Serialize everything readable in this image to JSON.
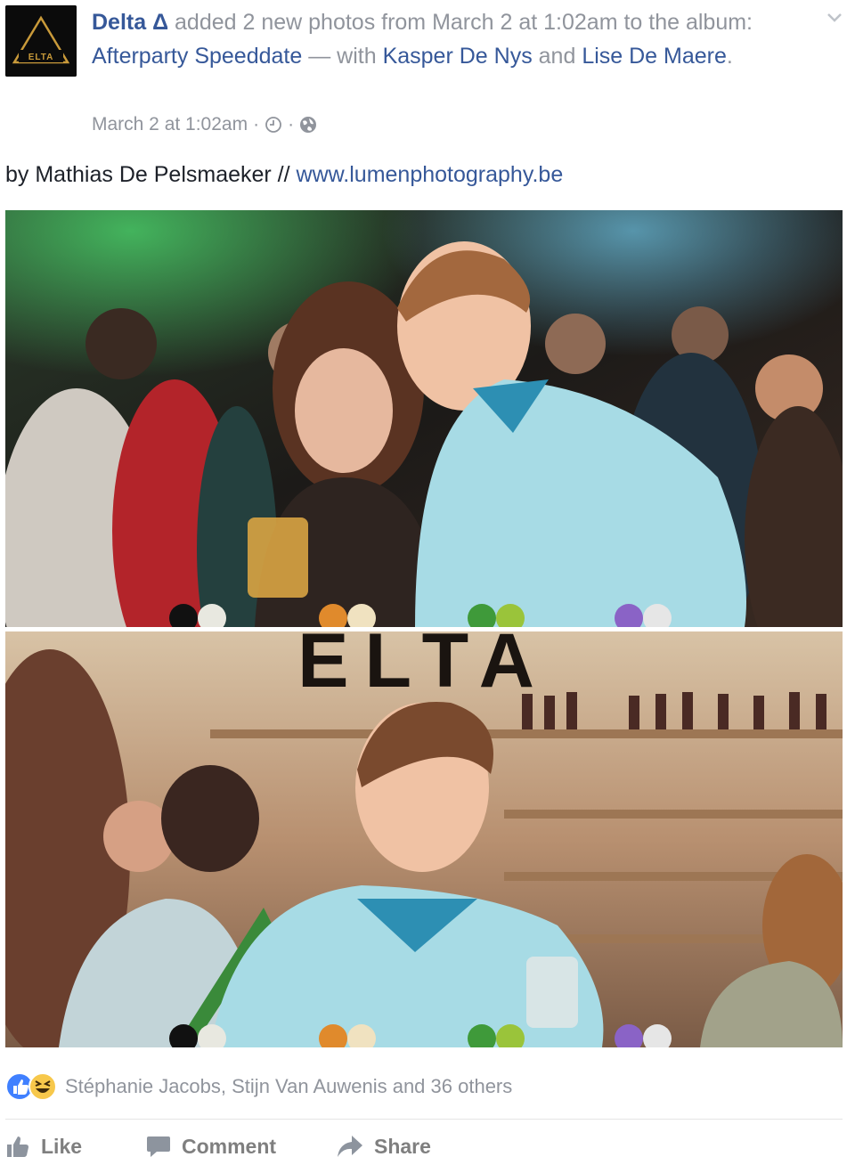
{
  "post": {
    "author": "Delta Δ",
    "action_text": " added 2 new photos from March 2 at 1:02am to the album: ",
    "album": "Afterparty Speeddate",
    "with_text": " — with ",
    "tagged_1": "Kasper De Nys",
    "and_text": " and ",
    "tagged_2": "Lise De Maere",
    "end_punct": ".",
    "timestamp": "March 2 at 1:02am",
    "separator": "·",
    "logo_text": "ELTA",
    "caption_prefix": "by Mathias De Pelsmaeker // ",
    "caption_link": "www.lumenphotography.be"
  },
  "photos": [
    {
      "alt": "Photo 1"
    },
    {
      "alt": "Photo 2",
      "sign_text": "ELTA"
    }
  ],
  "reactions": {
    "summary": "Stéphanie Jacobs, Stijn Van Auwenis and 36 others",
    "types": [
      "like-icon",
      "haha-icon"
    ]
  },
  "actions": {
    "like": "Like",
    "comment": "Comment",
    "share": "Share"
  },
  "colors": {
    "link": "#365899",
    "meta": "#90949c",
    "text": "#1d2129",
    "like_blue": "#4080ff",
    "haha_yellow": "#f7c84b"
  }
}
